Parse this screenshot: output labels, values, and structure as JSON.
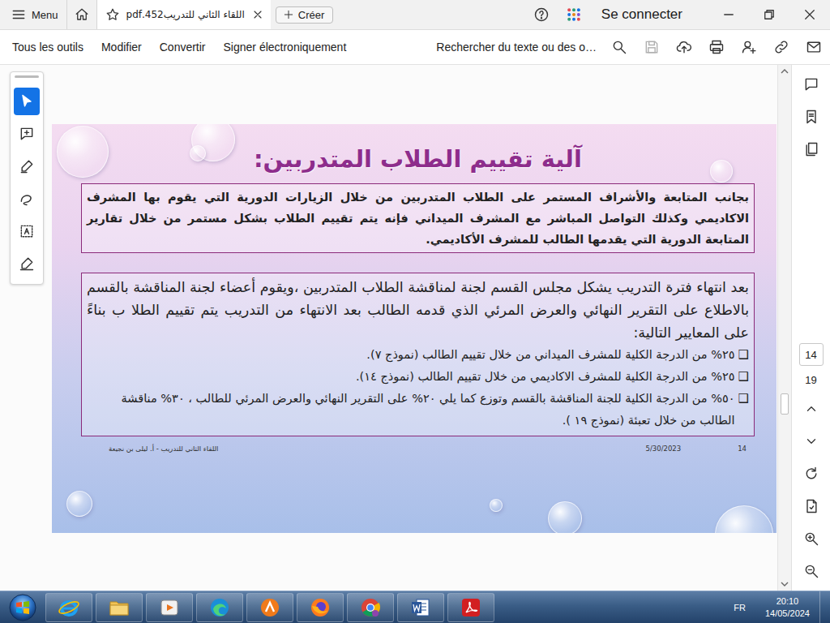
{
  "app_bar": {
    "menu": "Menu",
    "tab": {
      "title": "اللقاء الثاني للتدريب452.pdf",
      "selected": true
    },
    "create": "Créer",
    "sign_in": "Se connecter"
  },
  "toolbar": {
    "items": [
      "Tous les outils",
      "Modifier",
      "Convertir",
      "Signer électroniquement"
    ],
    "search": "Rechercher du texte ou des o…"
  },
  "tools": [
    {
      "selected": true
    },
    {
      "selected": false
    },
    {
      "selected": false
    },
    {
      "selected": false
    },
    {
      "selected": false
    },
    {
      "selected": false
    }
  ],
  "scrollbar": {
    "level": 0.66
  },
  "page_nav": {
    "current": "14",
    "total": "19"
  },
  "slide": {
    "title": "آلية تقييم الطلاب المتدربين:",
    "intro": "بجانب المتابعة والأشراف المستمر على الطلاب المتدربين من خلال الزيارات الدورية التي يقوم بها المشرف الاكاديمي وكذلك التواصل المباشر مع المشرف الميداني فإنه يتم تقييم الطلاب بشكل مستمر من خلال تقارير المتابعة الدورية التي يقدمها الطالب للمشرف الأكاديمي.",
    "body": "بعد انتهاء فترة التدريب يشكل مجلس القسم لجنة لمناقشة الطلاب المتدربين ،ويقوم أعضاء لجنة المناقشة بالقسم بالاطلاع على التقرير النهائي والعرض المرئي الذي قدمه الطالب بعد الانتهاء من التدريب يتم تقييم الطلا ب بناءً على المعايير التالية:",
    "bullets": [
      {
        "marker": "❑",
        "text": "٢٥% من الدرجة الكلية للمشرف الميداني من خلال تقييم الطالب (نموذج ٧)."
      },
      {
        "marker": "❑",
        "text": "٢٥% من الدرجة الكلية للمشرف الاكاديمي من خلال تقييم الطالب (نموذج ١٤)."
      },
      {
        "marker": "❑",
        "text": "٥٠% من الدرجة الكلية للجنة المناقشة بالقسم وتوزع كما يلي ٢٠% على التقرير النهائي والعرض المرئي للطالب ، ٣٠% مناقشة الطالب من خلال تعبئة (نموذج ١٩ )."
      }
    ],
    "footer": {
      "author": "اللقاء الثاني للتدريب - أ. ليلى بن نجيعة",
      "date": "5/30/2023",
      "page": "14"
    }
  },
  "taskbar": {
    "language": "FR",
    "time": "20:10",
    "date": "14/05/2024"
  }
}
